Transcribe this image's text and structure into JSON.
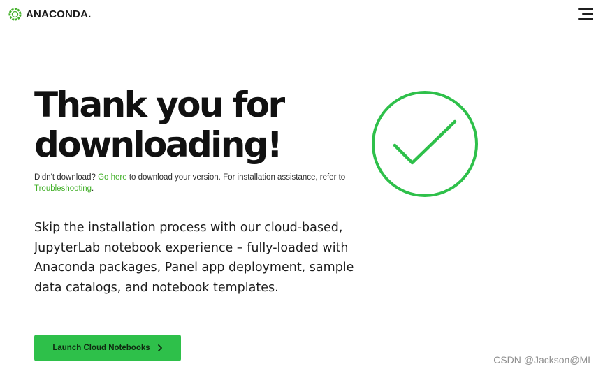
{
  "header": {
    "logo_text": "ANACONDA.",
    "menu_icon": "hamburger-menu-icon"
  },
  "hero": {
    "headline": "Thank you for downloading!",
    "assist": {
      "prefix": "Didn't download? ",
      "link1": "Go here",
      "middle": " to download your version. For installation assistance, refer to ",
      "link2": "Troubleshooting",
      "suffix": "."
    },
    "lead": "Skip the installation process with our cloud-based, JupyterLab notebook experience – fully-loaded with Anaconda packages, Panel app deployment, sample data catalogs, and notebook templates.",
    "cta_label": "Launch Cloud Notebooks",
    "cta_icon": "chevron-right-icon",
    "check_icon": "checkmark-circle-icon"
  },
  "watermark": "CSDN @Jackson@ML",
  "colors": {
    "brand_green": "#43b02a",
    "button_green": "#2ec04a",
    "check_green": "#2ec04a"
  }
}
